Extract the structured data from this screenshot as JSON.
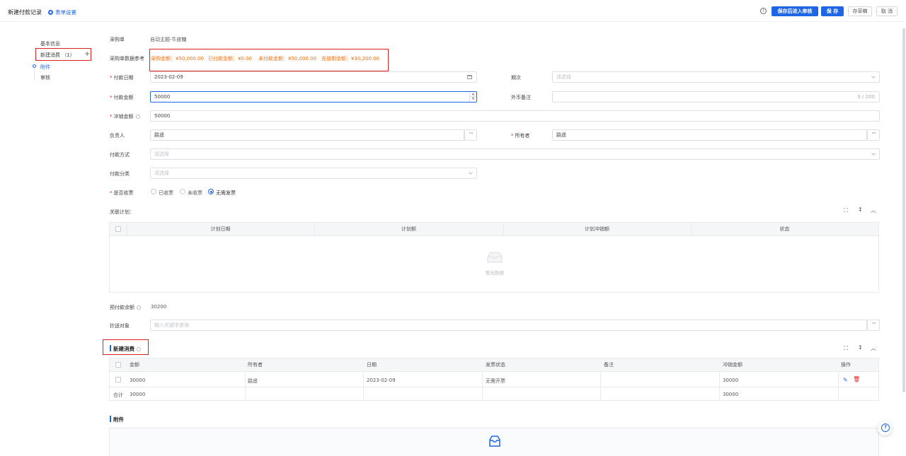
{
  "header": {
    "title": "新建付款记录",
    "form_setting": "表单设置",
    "save_and_review": "保存后进入审核",
    "save": "保 存",
    "draft": "存草稿",
    "cancel": "取 消"
  },
  "nav": {
    "items": [
      {
        "label": "基本信息"
      },
      {
        "label": "新建消费 （1）"
      },
      {
        "label": "附件"
      },
      {
        "label": "审核"
      }
    ]
  },
  "form": {
    "purchase_order": {
      "label": "采购单",
      "value": "自动主题-牛皮糖"
    },
    "purchase_ref": {
      "label": "采购单数据参考",
      "items": [
        "采购金额：¥50,000.00",
        "已付款金额：¥0.00",
        "未付款金额：¥50,000.00",
        "充值剩余额：¥30,200.00"
      ]
    },
    "pay_date": {
      "label": "付款日期",
      "value": "2023-02-09"
    },
    "period": {
      "label": "期次",
      "placeholder": "请选择"
    },
    "pay_amount": {
      "label": "付款金额",
      "value": "50000"
    },
    "fx_note": {
      "label": "外币备注",
      "counter": "0 / 200"
    },
    "offset_amount": {
      "label": "冲销金额",
      "value": "50000"
    },
    "owner_person": {
      "label": "负责人",
      "value": "路遥"
    },
    "holder": {
      "label": "所有者",
      "value": "路遥"
    },
    "pay_method": {
      "label": "付款方式",
      "placeholder": "请选择"
    },
    "pay_category": {
      "label": "付款分类",
      "placeholder": "请选择"
    },
    "invoice": {
      "label": "是否收票",
      "options": [
        "已收票",
        "未收票",
        "无需发票"
      ],
      "selected": "无需发票"
    },
    "related_plan_label": "关联计划：",
    "prepay_balance": {
      "label": "预付款余额",
      "value": "30200"
    },
    "cc": {
      "label": "抄送对象",
      "placeholder": "输入关键字查询"
    }
  },
  "plan_table": {
    "columns": [
      "计划日期",
      "计划额",
      "计划冲销额",
      "状态"
    ],
    "empty_text": "暂无数据"
  },
  "consume_section": {
    "title": "新建消费",
    "columns": [
      "金额",
      "所有者",
      "日期",
      "发票状态",
      "备注",
      "冲销金额",
      "操作"
    ],
    "rows": [
      {
        "amount": "30000",
        "owner": "路遥",
        "date": "2023-02-09",
        "invoice_status": "无需开票",
        "remark": "",
        "offset": "30000"
      }
    ],
    "total": {
      "label": "合计",
      "amount": "30000",
      "offset": "30000"
    }
  },
  "attach_section": {
    "title": "附件"
  }
}
